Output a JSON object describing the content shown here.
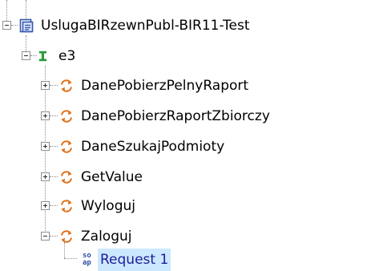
{
  "tree": {
    "root": {
      "label": "UslugaBIRzewnPubl-BIR11-Test",
      "icon": "project-icon",
      "expanded": true
    },
    "interface": {
      "label": "e3",
      "icon": "interface-icon",
      "expanded": true
    },
    "operations": [
      {
        "label": "DanePobierzPelnyRaport",
        "icon": "operation-icon",
        "expanded": false
      },
      {
        "label": "DanePobierzRaportZbiorczy",
        "icon": "operation-icon",
        "expanded": false
      },
      {
        "label": "DaneSzukajPodmioty",
        "icon": "operation-icon",
        "expanded": false
      },
      {
        "label": "GetValue",
        "icon": "operation-icon",
        "expanded": false
      },
      {
        "label": "Wyloguj",
        "icon": "operation-icon",
        "expanded": false
      },
      {
        "label": "Zaloguj",
        "icon": "operation-icon",
        "expanded": true
      }
    ],
    "request": {
      "label": "Request 1",
      "icon": "soap-request-icon",
      "icon_text_top": "so",
      "icon_text_bottom": "ap",
      "selected": true
    }
  },
  "colors": {
    "selection": "#cce8ff",
    "selected_text": "#1d1d9a",
    "operation_icon": "#e0701a",
    "interface_icon": "#2a9a3a",
    "project_icon": "#3355aa"
  }
}
